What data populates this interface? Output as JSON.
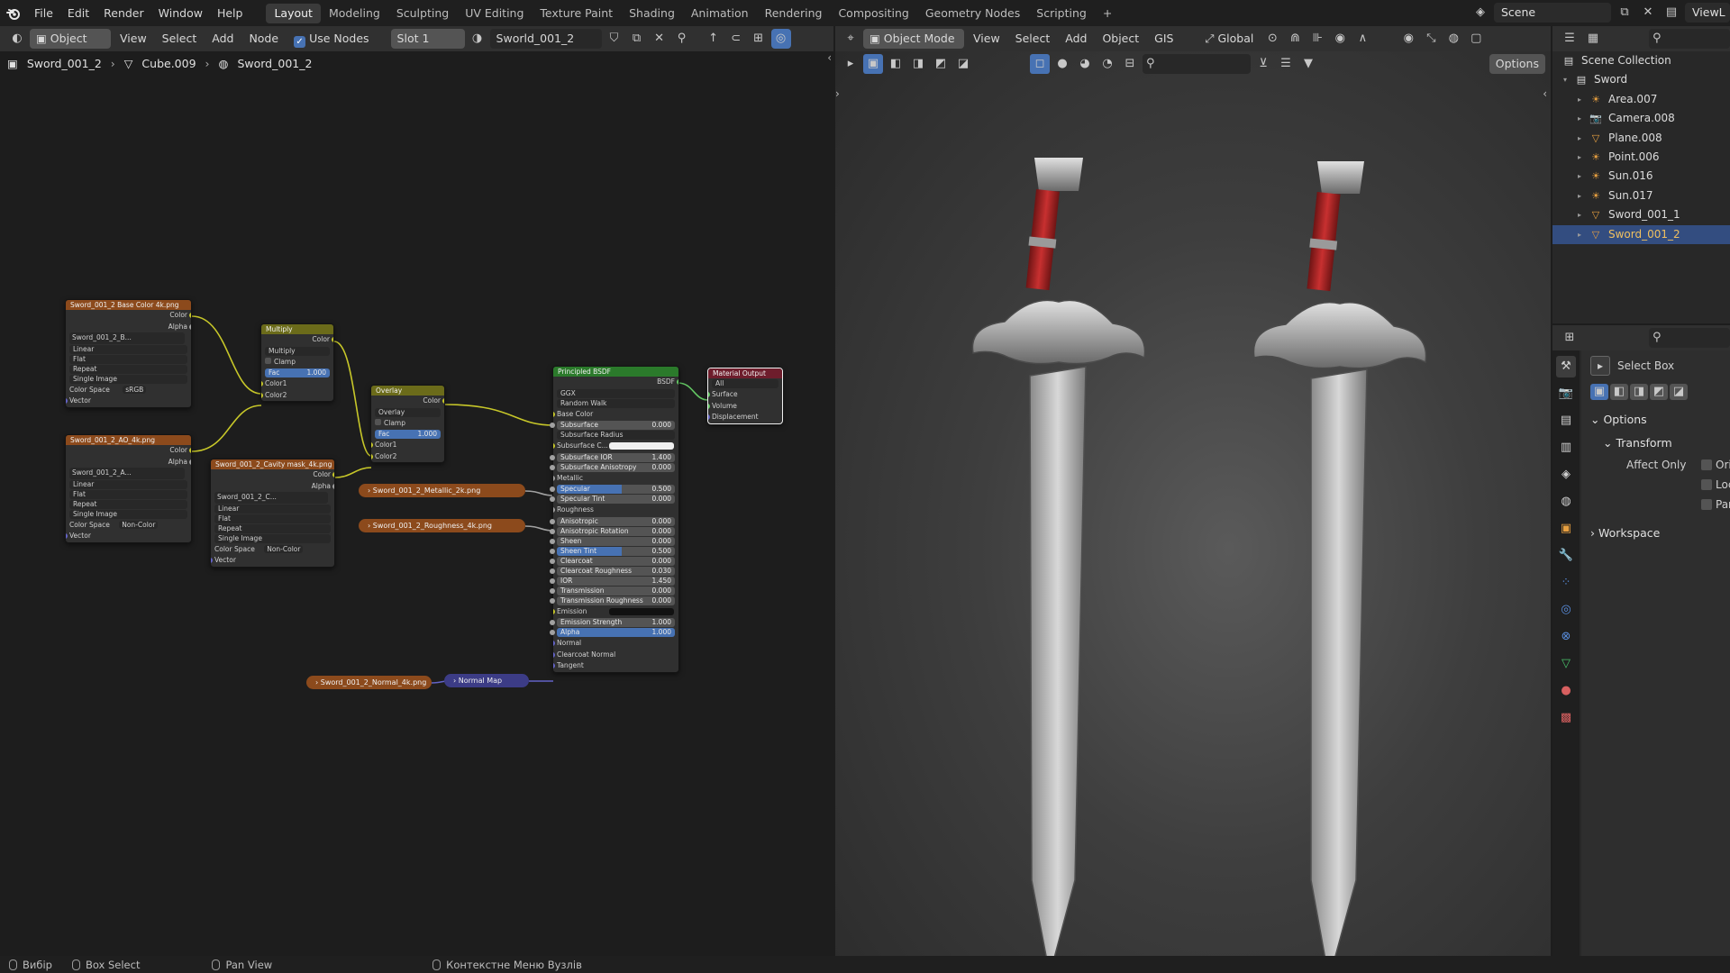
{
  "topbar": {
    "menus": [
      "File",
      "Edit",
      "Render",
      "Window",
      "Help"
    ],
    "workspaces": [
      "Layout",
      "Modeling",
      "Sculpting",
      "UV Editing",
      "Texture Paint",
      "Shading",
      "Animation",
      "Rendering",
      "Compositing",
      "Geometry Nodes",
      "Scripting"
    ],
    "active_workspace": "Layout",
    "add_tab": "+",
    "scene_name": "Scene",
    "view_layer": "ViewL"
  },
  "node_editor": {
    "header": {
      "object_type": "Object",
      "menus": [
        "View",
        "Select",
        "Add",
        "Node"
      ],
      "use_nodes_label": "Use Nodes",
      "slot": "Slot 1",
      "material_name": "Sworld_001_2"
    },
    "breadcrumb": [
      "Sword_001_2",
      "Cube.009",
      "Sword_001_2"
    ],
    "nodes": {
      "base_color": {
        "title": "Sword_001_2 Base Color 4k.png",
        "outputs": [
          "Color",
          "Alpha"
        ],
        "image_name": "Sword_001_2_B...",
        "interpolation": "Linear",
        "projection": "Flat",
        "extension": "Repeat",
        "source": "Single Image",
        "color_space_label": "Color Space",
        "color_space": "sRGB",
        "vector_label": "Vector"
      },
      "ao": {
        "title": "Sword_001_2_AO_4k.png",
        "outputs": [
          "Color",
          "Alpha"
        ],
        "image_name": "Sword_001_2_A...",
        "interpolation": "Linear",
        "projection": "Flat",
        "extension": "Repeat",
        "source": "Single Image",
        "color_space_label": "Color Space",
        "color_space": "Non-Color",
        "vector_label": "Vector"
      },
      "cavity": {
        "title": "Sword_001_2_Cavity mask_4k.png",
        "outputs": [
          "Color",
          "Alpha"
        ],
        "image_name": "Sword_001_2_C...",
        "interpolation": "Linear",
        "projection": "Flat",
        "extension": "Repeat",
        "source": "Single Image",
        "color_space_label": "Color Space",
        "color_space": "Non-Color",
        "vector_label": "Vector"
      },
      "multiply": {
        "title": "Multiply",
        "output": "Color",
        "blend": "Multiply",
        "clamp": "Clamp",
        "fac_label": "Fac",
        "fac": "1.000",
        "inputs": [
          "Color1",
          "Color2"
        ]
      },
      "overlay": {
        "title": "Overlay",
        "output": "Color",
        "blend": "Overlay",
        "clamp": "Clamp",
        "fac_label": "Fac",
        "fac": "1.000",
        "inputs": [
          "Color1",
          "Color2"
        ]
      },
      "metallic": {
        "title": "Sword_001_2_Metallic_2k.png"
      },
      "roughness": {
        "title": "Sword_001_2_Roughness_4k.png"
      },
      "normal_tex": {
        "title": "Sword_001_2_Normal_4k.png"
      },
      "normal_map": {
        "title": "Normal Map"
      },
      "bsdf": {
        "title": "Principled BSDF",
        "output": "BSDF",
        "distribution": "GGX",
        "subsurface_method": "Random Walk",
        "rows": [
          {
            "label": "Base Color",
            "kind": "socket"
          },
          {
            "label": "Subsurface",
            "kind": "slider",
            "value": "0.000"
          },
          {
            "label": "Subsurface Radius",
            "kind": "dropdown",
            "value": ""
          },
          {
            "label": "Subsurface C...",
            "kind": "color",
            "value": ""
          },
          {
            "label": "Subsurface IOR",
            "kind": "slider",
            "value": "1.400"
          },
          {
            "label": "Subsurface Anisotropy",
            "kind": "slider",
            "value": "0.000"
          },
          {
            "label": "Metallic",
            "kind": "socket"
          },
          {
            "label": "Specular",
            "kind": "slider-blue",
            "value": "0.500"
          },
          {
            "label": "Specular Tint",
            "kind": "slider",
            "value": "0.000"
          },
          {
            "label": "Roughness",
            "kind": "socket"
          },
          {
            "label": "Anisotropic",
            "kind": "slider",
            "value": "0.000"
          },
          {
            "label": "Anisotropic Rotation",
            "kind": "slider",
            "value": "0.000"
          },
          {
            "label": "Sheen",
            "kind": "slider",
            "value": "0.000"
          },
          {
            "label": "Sheen Tint",
            "kind": "slider-blue",
            "value": "0.500"
          },
          {
            "label": "Clearcoat",
            "kind": "slider",
            "value": "0.000"
          },
          {
            "label": "Clearcoat Roughness",
            "kind": "slider",
            "value": "0.030"
          },
          {
            "label": "IOR",
            "kind": "slider",
            "value": "1.450"
          },
          {
            "label": "Transmission",
            "kind": "slider",
            "value": "0.000"
          },
          {
            "label": "Transmission Roughness",
            "kind": "slider",
            "value": "0.000"
          },
          {
            "label": "Emission",
            "kind": "color-dark",
            "value": ""
          },
          {
            "label": "Emission Strength",
            "kind": "slider",
            "value": "1.000"
          },
          {
            "label": "Alpha",
            "kind": "slider-full",
            "value": "1.000"
          },
          {
            "label": "Normal",
            "kind": "socket"
          },
          {
            "label": "Clearcoat Normal",
            "kind": "socket"
          },
          {
            "label": "Tangent",
            "kind": "socket"
          }
        ]
      },
      "output": {
        "title": "Material Output",
        "target": "All",
        "inputs": [
          "Surface",
          "Volume",
          "Displacement"
        ]
      }
    }
  },
  "viewport": {
    "header": {
      "mode": "Object Mode",
      "menus": [
        "View",
        "Select",
        "Add",
        "Object",
        "GIS"
      ],
      "orientation": "Global",
      "options_label": "Options"
    }
  },
  "outliner": {
    "collection": "Scene Collection",
    "items": [
      {
        "name": "Sword",
        "icon": "collection-icon",
        "level": 1
      },
      {
        "name": "Area.007",
        "icon": "light-icon",
        "level": 2
      },
      {
        "name": "Camera.008",
        "icon": "camera-icon",
        "level": 2
      },
      {
        "name": "Plane.008",
        "icon": "mesh-icon",
        "level": 2
      },
      {
        "name": "Point.006",
        "icon": "light-icon",
        "level": 2
      },
      {
        "name": "Sun.016",
        "icon": "light-icon",
        "level": 2
      },
      {
        "name": "Sun.017",
        "icon": "light-icon",
        "level": 2
      },
      {
        "name": "Sword_001_1",
        "icon": "mesh-icon",
        "level": 2
      },
      {
        "name": "Sword_001_2",
        "icon": "mesh-icon",
        "level": 2,
        "selected": true
      }
    ]
  },
  "properties": {
    "tool_name": "Select Box",
    "panels": {
      "options": "Options",
      "transform": "Transform",
      "affect_only": "Affect Only",
      "affect_items": [
        "Ori",
        "Loc",
        "Par"
      ],
      "workspace": "Workspace"
    }
  },
  "statusbar": {
    "items": [
      "Вибір",
      "Box Select",
      "Pan View",
      "Контекстне Меню Вузлів"
    ]
  },
  "colors": {
    "accent_blue": "#4772b3",
    "selection": "#334d80",
    "texture_node": "#8c4a1c",
    "color_node": "#6b6b1a",
    "shader_node": "#2b7a2b",
    "output_node": "#6e1d2c",
    "vector_node": "#3c3c86"
  }
}
